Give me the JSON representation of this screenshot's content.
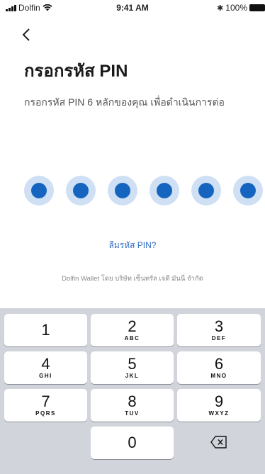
{
  "status_bar": {
    "carrier": "Dolfin",
    "time": "9:41 AM",
    "battery": "100%"
  },
  "header": {
    "back_icon": "chevron-left-icon",
    "title": "กรอกรหัส PIN"
  },
  "subtitle": "กรอกรหัส PIN 6 หลักของคุณ เพื่อดำเนินการต่อ",
  "pin": {
    "length": 6,
    "filled": 6,
    "colors": {
      "dot": "#1565c0",
      "halo": "#cfe0f4"
    }
  },
  "forgot_pin_label": "ลืมรหัส PIN?",
  "footer": "Dolfin Wallet โดย บริษัท เซ็นทรัล เจดี มันนี่ จำกัด",
  "keypad": {
    "keys": [
      {
        "num": "1",
        "letters": ""
      },
      {
        "num": "2",
        "letters": "ABC"
      },
      {
        "num": "3",
        "letters": "DEF"
      },
      {
        "num": "4",
        "letters": "GHI"
      },
      {
        "num": "5",
        "letters": "JKL"
      },
      {
        "num": "6",
        "letters": "MNO"
      },
      {
        "num": "7",
        "letters": "PQRS"
      },
      {
        "num": "8",
        "letters": "TUV"
      },
      {
        "num": "9",
        "letters": "WXYZ"
      },
      {
        "num": "0",
        "letters": ""
      }
    ],
    "delete_icon": "backspace-icon"
  }
}
